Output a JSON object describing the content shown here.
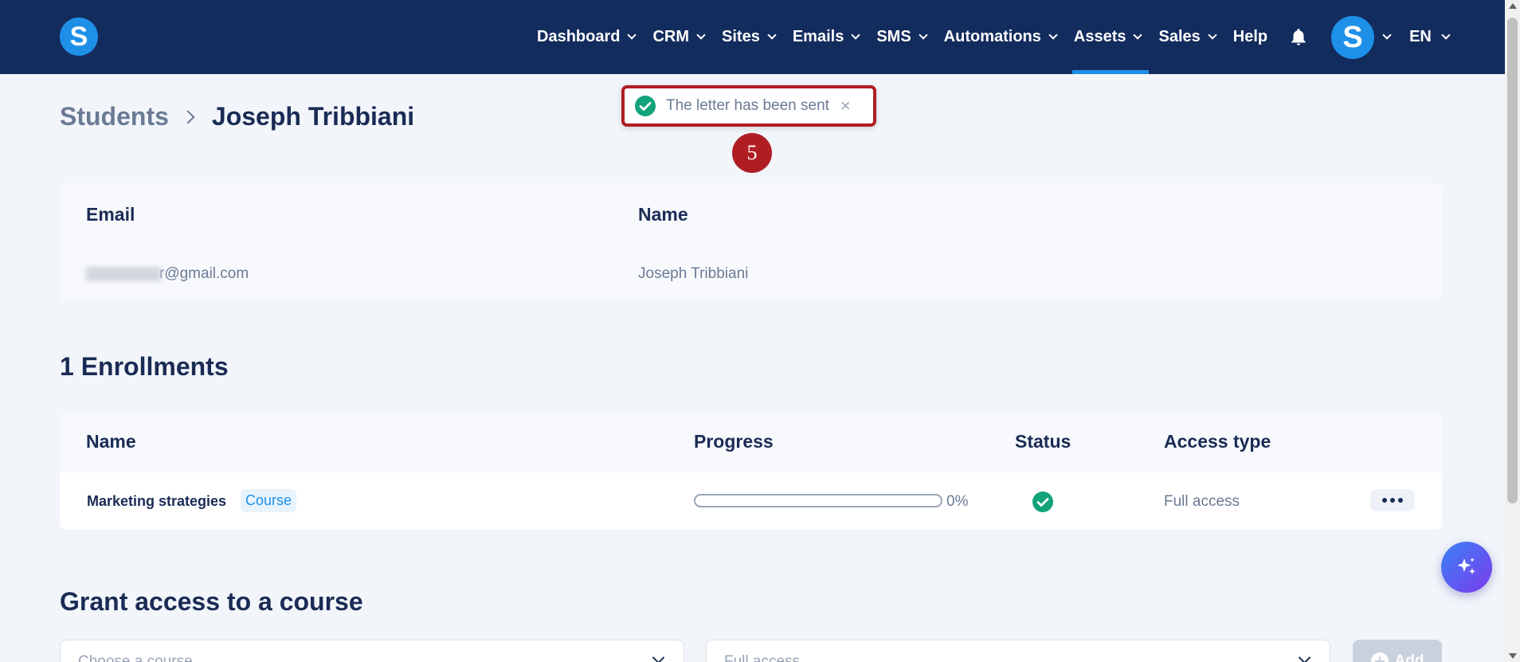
{
  "app": {
    "logo_letter": "S",
    "brand_color": "#1e90e8",
    "nav_bg": "#132c5e"
  },
  "nav": {
    "items": [
      {
        "label": "Dashboard",
        "has_dropdown": true
      },
      {
        "label": "CRM",
        "has_dropdown": true
      },
      {
        "label": "Sites",
        "has_dropdown": true
      },
      {
        "label": "Emails",
        "has_dropdown": true
      },
      {
        "label": "SMS",
        "has_dropdown": true
      },
      {
        "label": "Automations",
        "has_dropdown": true
      },
      {
        "label": "Assets",
        "has_dropdown": true,
        "active": true
      },
      {
        "label": "Sales",
        "has_dropdown": true
      },
      {
        "label": "Help",
        "has_dropdown": false
      }
    ],
    "bell_icon": "bell-icon",
    "avatar_letter": "S",
    "language": "EN"
  },
  "breadcrumb": {
    "root": "Students",
    "current": "Joseph Tribbiani"
  },
  "toast": {
    "message": "The letter has been sent",
    "close": "×",
    "step_number": "5",
    "highlight_color": "#b01e24"
  },
  "student": {
    "email_label": "Email",
    "email_visible": "r@gmail.com",
    "name_label": "Name",
    "name_value": "Joseph Tribbiani"
  },
  "enrollments": {
    "title": "1 Enrollments",
    "columns": [
      "Name",
      "Progress",
      "Status",
      "Access type"
    ],
    "rows": [
      {
        "name": "Marketing strategies",
        "type_badge": "Course",
        "progress_percent": 0,
        "progress_text": "0%",
        "status": "complete",
        "access_type": "Full access"
      }
    ]
  },
  "grant_access": {
    "title": "Grant access to a course",
    "course_placeholder": "Choose a course",
    "access_value": "Full access",
    "add_label": "Add"
  }
}
